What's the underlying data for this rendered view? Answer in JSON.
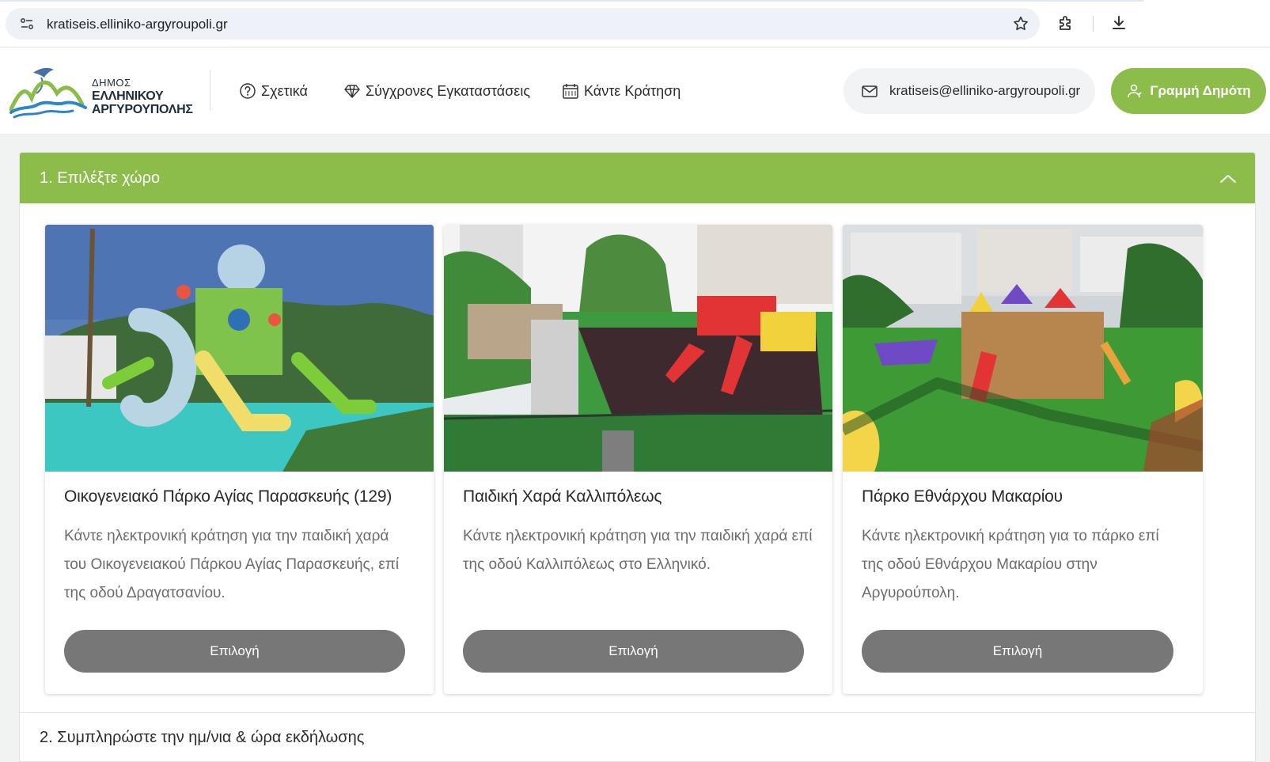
{
  "browser": {
    "url": "kratiseis.elliniko-argyroupoli.gr"
  },
  "header": {
    "logo": {
      "line1": "ΔΗΜΟΣ",
      "line2": "ΕΛΛΗΝΙΚΟΥ",
      "line3": "ΑΡΓΥΡΟΥΠΟΛΗΣ"
    },
    "nav": [
      {
        "label": "Σχετικά",
        "icon": "question-circle-icon"
      },
      {
        "label": "Σύγχρονες Εγκαταστάσεις",
        "icon": "diamond-icon"
      },
      {
        "label": "Κάντε Κράτηση",
        "icon": "calendar-icon"
      }
    ],
    "email": "kratiseis@elliniko-argyroupoli.gr",
    "hotline_label": "Γραμμή Δημότη"
  },
  "steps": {
    "step1_title": "1. Επιλέξτε χώρο",
    "step2_title": "2. Συμπληρώστε την ημ/νια & ώρα εκδήλωσης"
  },
  "cards": [
    {
      "title": "Οικογενειακό Πάρκο Αγίας Παρασκευής (129)",
      "description": "Κάντε ηλεκτρονική κράτηση για την παιδική χαρά του Οικογενειακού Πάρκου Αγίας Παρασκευής, επί της οδού Δραγατσανίου.",
      "button": "Επιλογή"
    },
    {
      "title": "Παιδική Χαρά Καλλιπόλεως",
      "description": "Κάντε ηλεκτρονική κράτηση για την παιδική χαρά επί της οδού Καλλιπόλεως στο Ελληνικό.",
      "button": "Επιλογή"
    },
    {
      "title": "Πάρκο Εθνάρχου Μακαρίου",
      "description": "Κάντε ηλεκτρονική κράτηση για το πάρκο επί της οδού Εθνάρχου Μακαρίου στην Αργυρούπολη.",
      "button": "Επιλογή"
    }
  ],
  "colors": {
    "brand_green": "#8cbc4a",
    "button_gray": "#777777"
  }
}
